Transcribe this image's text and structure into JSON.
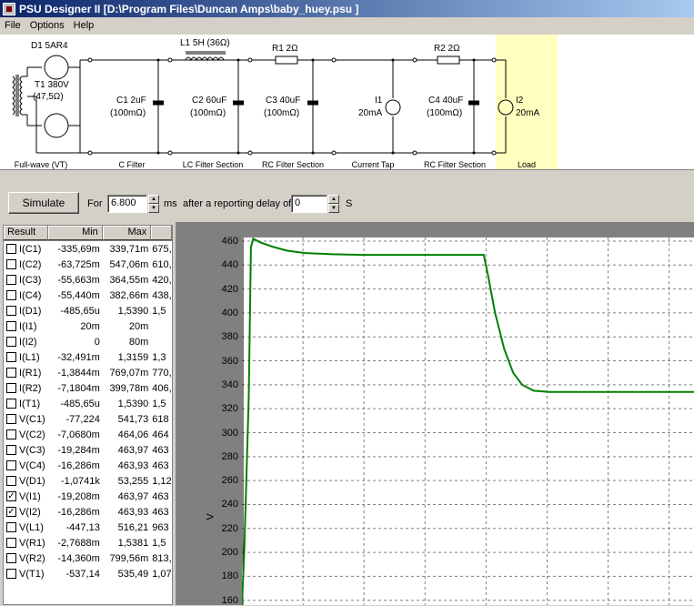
{
  "window": {
    "title": "PSU Designer II  [D:\\Program Files\\Duncan Amps\\baby_huey.psu ]"
  },
  "menu": [
    "File",
    "Options",
    "Help"
  ],
  "schematic": {
    "components": {
      "d1": "D1  5AR4",
      "t1_a": "T1 380V",
      "t1_b": "(47,5Ω)",
      "l1": "L1 5H (36Ω)",
      "r1": "R1 2Ω",
      "r2": "R2 2Ω",
      "c1_a": "C1 2uF",
      "c1_b": "(100mΩ)",
      "c2_a": "C2 60uF",
      "c2_b": "(100mΩ)",
      "c3_a": "C3 40uF",
      "c3_b": "(100mΩ)",
      "i1_a": "I1",
      "i1_b": "20mA",
      "c4_a": "C4 40uF",
      "c4_b": "(100mΩ)",
      "i2_a": "I2",
      "i2_b": "20mA"
    },
    "sections": [
      "Full-wave (VT)",
      "C Filter",
      "LC Filter Section",
      "RC Filter Section",
      "Current Tap",
      "RC Filter Section",
      "Load"
    ]
  },
  "controls": {
    "simulate": "Simulate",
    "for": "For",
    "duration": "6.800",
    "ms": "ms",
    "delay_text": "after a reporting delay of",
    "delay": "0",
    "s": "S"
  },
  "results": {
    "headers": [
      "Result",
      "Min",
      "Max",
      ""
    ],
    "rows": [
      {
        "name": "I(C1)",
        "min": "-335,69m",
        "max": "339,71m",
        "extra": "675,",
        "checked": false
      },
      {
        "name": "I(C2)",
        "min": "-63,725m",
        "max": "547,06m",
        "extra": "610,",
        "checked": false
      },
      {
        "name": "I(C3)",
        "min": "-55,663m",
        "max": "364,55m",
        "extra": "420,",
        "checked": false
      },
      {
        "name": "I(C4)",
        "min": "-55,440m",
        "max": "382,66m",
        "extra": "438,",
        "checked": false
      },
      {
        "name": "I(D1)",
        "min": "-485,65u",
        "max": "1,5390",
        "extra": "1,5",
        "checked": false
      },
      {
        "name": "I(I1)",
        "min": "20m",
        "max": "20m",
        "extra": "",
        "checked": false
      },
      {
        "name": "I(I2)",
        "min": "0",
        "max": "80m",
        "extra": "",
        "checked": false
      },
      {
        "name": "I(L1)",
        "min": "-32,491m",
        "max": "1,3159",
        "extra": "1,3",
        "checked": false
      },
      {
        "name": "I(R1)",
        "min": "-1,3844m",
        "max": "769,07m",
        "extra": "770,",
        "checked": false
      },
      {
        "name": "I(R2)",
        "min": "-7,1804m",
        "max": "399,78m",
        "extra": "406,",
        "checked": false
      },
      {
        "name": "I(T1)",
        "min": "-485,65u",
        "max": "1,5390",
        "extra": "1,5",
        "checked": false
      },
      {
        "name": "V(C1)",
        "min": "-77,224",
        "max": "541,73",
        "extra": "618",
        "checked": false
      },
      {
        "name": "V(C2)",
        "min": "-7,0680m",
        "max": "464,06",
        "extra": "464",
        "checked": false
      },
      {
        "name": "V(C3)",
        "min": "-19,284m",
        "max": "463,97",
        "extra": "463",
        "checked": false
      },
      {
        "name": "V(C4)",
        "min": "-16,286m",
        "max": "463,93",
        "extra": "463",
        "checked": false
      },
      {
        "name": "V(D1)",
        "min": "-1,0741k",
        "max": "53,255",
        "extra": "1,12",
        "checked": false
      },
      {
        "name": "V(I1)",
        "min": "-19,208m",
        "max": "463,97",
        "extra": "463",
        "checked": true
      },
      {
        "name": "V(I2)",
        "min": "-16,286m",
        "max": "463,93",
        "extra": "463",
        "checked": true
      },
      {
        "name": "V(L1)",
        "min": "-447,13",
        "max": "516,21",
        "extra": "963",
        "checked": false
      },
      {
        "name": "V(R1)",
        "min": "-2,7688m",
        "max": "1,5381",
        "extra": "1,5",
        "checked": false
      },
      {
        "name": "V(R2)",
        "min": "-14,360m",
        "max": "799,56m",
        "extra": "813,",
        "checked": false
      },
      {
        "name": "V(T1)",
        "min": "-537,14",
        "max": "535,49",
        "extra": "1,07",
        "checked": false
      }
    ]
  },
  "chart_data": {
    "type": "line",
    "ylabel": "V",
    "yticks": [
      460,
      440,
      420,
      400,
      380,
      360,
      340,
      320,
      300,
      280,
      260,
      240,
      220,
      200,
      180,
      160
    ],
    "ylim": [
      156,
      463
    ],
    "xlim": [
      0,
      1
    ],
    "series": [
      {
        "color": "#008000",
        "points": [
          [
            0,
            156
          ],
          [
            0.005,
            200
          ],
          [
            0.015,
            330
          ],
          [
            0.02,
            455
          ],
          [
            0.025,
            462
          ],
          [
            0.04,
            459
          ],
          [
            0.07,
            455
          ],
          [
            0.1,
            452
          ],
          [
            0.14,
            450
          ],
          [
            0.2,
            449
          ],
          [
            0.27,
            448.5
          ],
          [
            0.5,
            448.5
          ],
          [
            0.535,
            448.5
          ],
          [
            0.545,
            430
          ],
          [
            0.56,
            400
          ],
          [
            0.58,
            370
          ],
          [
            0.6,
            350
          ],
          [
            0.62,
            340
          ],
          [
            0.645,
            335
          ],
          [
            0.68,
            334
          ],
          [
            1,
            334
          ]
        ]
      }
    ]
  },
  "colors": {
    "title_bg": "#0a246a",
    "load_bg": "#ffffc0",
    "trace": "#008000"
  }
}
